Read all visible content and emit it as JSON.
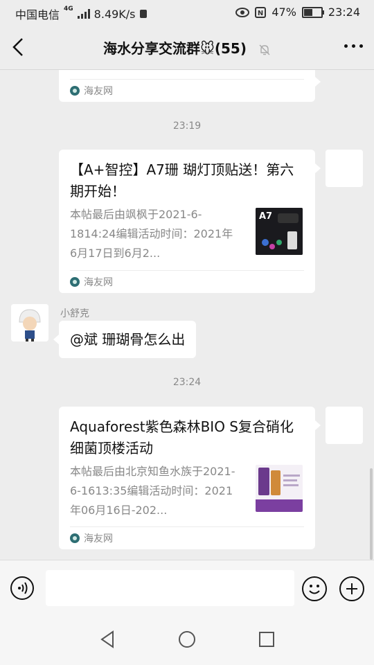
{
  "status_bar": {
    "carrier": "中国电信",
    "network_type": "4G",
    "speed": "8.49K/s",
    "battery_percent": "47%",
    "battery_level": 0.47,
    "time": "23:24"
  },
  "header": {
    "title": "海水分享交流群🐭(55)",
    "icons": [
      "back-arrow-icon",
      "mute-bell-icon",
      "more-icon"
    ]
  },
  "messages": [
    {
      "type": "link_card_partial",
      "source": "海友网"
    },
    {
      "type": "timestamp",
      "text": "23:19"
    },
    {
      "type": "link_card",
      "title": "【A+智控】A7珊 瑚灯顶贴送！第六期开始！",
      "desc": "本帖最后由飒枫于2021-6-1814:24编辑活动时间：2021年6月17日到6月2...",
      "thumb_label": "A7",
      "source": "海友网"
    },
    {
      "type": "text",
      "sender": "小舒克",
      "text": "@斌  珊瑚骨怎么出"
    },
    {
      "type": "timestamp",
      "text": "23:24"
    },
    {
      "type": "link_card",
      "title": "Aquaforest紫色森林BIO S复合硝化细菌顶楼活动",
      "desc": "本帖最后由北京知鱼水族于2021-6-1613:35编辑活动时间：2021年06月16日-202...",
      "source": "海友网"
    }
  ],
  "input_bar": {
    "placeholder": "",
    "icons": [
      "voice-icon",
      "emoji-icon",
      "plus-icon"
    ]
  },
  "nav_bar": {
    "icons": [
      "back-triangle-icon",
      "home-circle-icon",
      "recents-square-icon"
    ]
  },
  "colors": {
    "background": "#ededed",
    "bubble": "#ffffff",
    "muted_text": "#888888"
  }
}
